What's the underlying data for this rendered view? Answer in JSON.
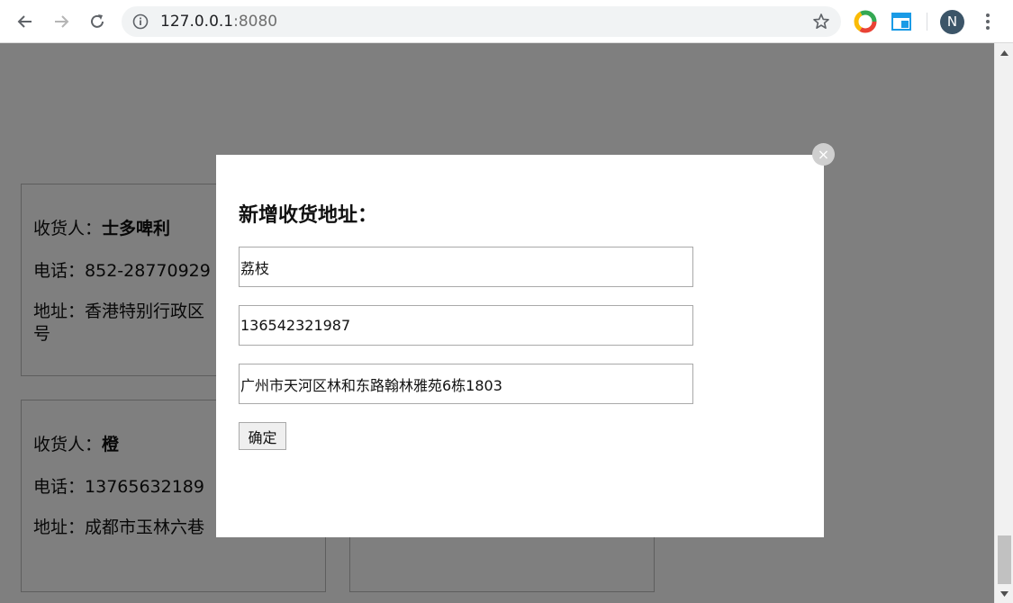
{
  "browser": {
    "url_host": "127.0.0.1",
    "url_port": ":8080",
    "avatar_initial": "N"
  },
  "cards": [
    {
      "name_label": "收货人：",
      "name": "士多啤利",
      "phone_label": "电话：",
      "phone": "852-28770929",
      "address_label": "地址：",
      "address_visible": "香港特别行政区",
      "address_wrap": "号"
    },
    {
      "name_label": "收货人：",
      "name": "橙",
      "phone_label": "电话：",
      "phone": "13765632189",
      "address_label": "地址：",
      "address_visible": "成都市玉林六巷"
    }
  ],
  "modal": {
    "title": "新增收货地址：",
    "name_value": "荔枝",
    "phone_value": "136542321987",
    "address_value": "广州市天河区林和东路翰林雅苑6栋1803",
    "confirm_label": "确定",
    "close_symbol": "×"
  },
  "colors": {
    "overlay": "rgba(0,0,0,0.5)",
    "avatar_bg": "#3c5568",
    "omnibox_bg": "#f1f3f4"
  },
  "icons": [
    "back-arrow-icon",
    "forward-arrow-icon",
    "reload-icon",
    "info-icon",
    "star-icon",
    "chrome-extension-icon",
    "window-extension-icon",
    "menu-dots-icon",
    "close-icon"
  ]
}
